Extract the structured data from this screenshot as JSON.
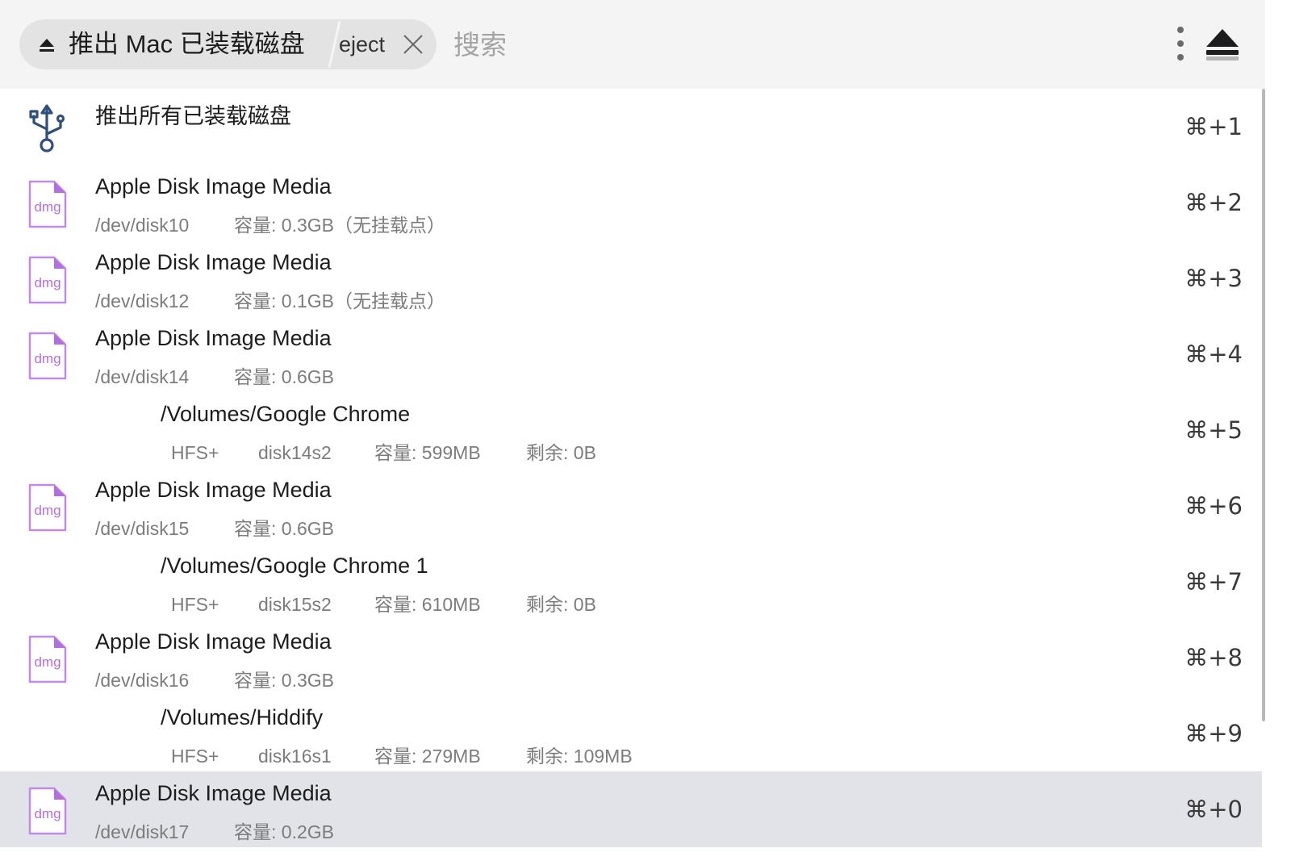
{
  "header": {
    "breadcrumb_title": "推出 Mac 已装载磁盘",
    "keyword": "eject",
    "search_placeholder": "搜索",
    "search_value": ""
  },
  "rows": [
    {
      "kind": "action",
      "icon": "usb-icon",
      "title": "推出所有已装载磁盘",
      "shortcut": "⌘+1"
    },
    {
      "kind": "disk",
      "icon": "dmg-file-icon",
      "icon_text": "dmg",
      "title": "Apple Disk Image Media",
      "dev": "/dev/disk10",
      "info": "容量: 0.3GB（无挂载点）",
      "shortcut": "⌘+2"
    },
    {
      "kind": "disk",
      "icon": "dmg-file-icon",
      "icon_text": "dmg",
      "title": "Apple Disk Image Media",
      "dev": "/dev/disk12",
      "info": "容量: 0.1GB（无挂载点）",
      "shortcut": "⌘+3"
    },
    {
      "kind": "disk",
      "icon": "dmg-file-icon",
      "icon_text": "dmg",
      "title": "Apple Disk Image Media",
      "dev": "/dev/disk14",
      "info": "容量: 0.6GB",
      "shortcut": "⌘+4"
    },
    {
      "kind": "volume",
      "title": "/Volumes/Google Chrome",
      "fs": "HFS+",
      "disk": "disk14s2",
      "capacity": "容量: 599MB",
      "free": "剩余: 0B",
      "shortcut": "⌘+5"
    },
    {
      "kind": "disk",
      "icon": "dmg-file-icon",
      "icon_text": "dmg",
      "title": "Apple Disk Image Media",
      "dev": "/dev/disk15",
      "info": "容量: 0.6GB",
      "shortcut": "⌘+6"
    },
    {
      "kind": "volume",
      "title": "/Volumes/Google Chrome 1",
      "fs": "HFS+",
      "disk": "disk15s2",
      "capacity": "容量: 610MB",
      "free": "剩余: 0B",
      "shortcut": "⌘+7"
    },
    {
      "kind": "disk",
      "icon": "dmg-file-icon",
      "icon_text": "dmg",
      "title": "Apple Disk Image Media",
      "dev": "/dev/disk16",
      "info": "容量: 0.3GB",
      "shortcut": "⌘+8"
    },
    {
      "kind": "volume",
      "title": "/Volumes/Hiddify",
      "fs": "HFS+",
      "disk": "disk16s1",
      "capacity": "容量: 279MB",
      "free": "剩余: 109MB",
      "shortcut": "⌘+9"
    },
    {
      "kind": "disk",
      "icon": "dmg-file-icon",
      "icon_text": "dmg",
      "title": "Apple Disk Image Media",
      "dev": "/dev/disk17",
      "info": "容量: 0.2GB",
      "shortcut": "⌘+0",
      "selected": true
    }
  ],
  "colors": {
    "header_bg": "#f4f4f4",
    "chip_bg": "#e3e3e3",
    "selected_row": "#e2e3e8",
    "dmg_accent": "#b36ee0",
    "usb_blue": "#2f4f7f"
  }
}
